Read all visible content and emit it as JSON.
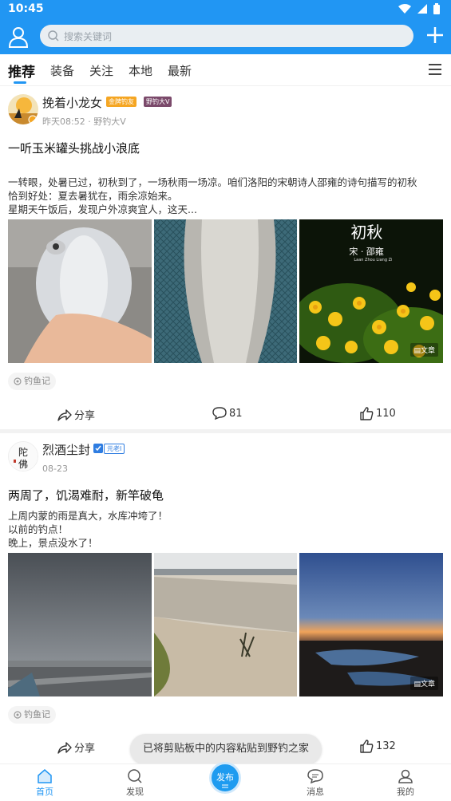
{
  "status_bar": {
    "time": "10:45"
  },
  "search": {
    "placeholder": "搜索关键词"
  },
  "tabs": [
    {
      "label": "推荐",
      "active": true
    },
    {
      "label": "装备"
    },
    {
      "label": "关注"
    },
    {
      "label": "本地"
    },
    {
      "label": "最新"
    }
  ],
  "posts": [
    {
      "author": "挽着小龙女",
      "badges": [
        "金牌钓友",
        "野钓大V"
      ],
      "meta": "昨天08:52 · 野钓大V",
      "title": "一听玉米罐头挑战小浪底",
      "body": [
        "一转眼，处暑已过，初秋到了，一场秋雨一场凉。咱们洛阳的宋朝诗人邵雍的诗句描写的初秋",
        "恰到好处：夏去暑犹在，雨余凉始来。",
        "星期天午饭后，发现户外凉爽宜人，这天..."
      ],
      "images": [
        {
          "desc": "fish-in-hand"
        },
        {
          "desc": "fish-in-net"
        },
        {
          "desc": "poem-flowers",
          "caption_title": "初秋",
          "caption_sub": "宋 · 邵雍",
          "caption_pinyin": "Laan Zhou Liang Zi",
          "tag": "文章"
        }
      ],
      "topic": "钓鱼记",
      "share_label": "分享",
      "comments": "81",
      "likes": "110"
    },
    {
      "author": "烈酒尘封",
      "badges": [
        "元老Ⅰ"
      ],
      "meta": "08-23",
      "title": "两周了，饥渴难耐，新竿破龟",
      "body": [
        "上周内蒙的雨是真大，水库冲垮了！",
        "以前的钓点！",
        "晚上，景点没水了！"
      ],
      "images": [
        {
          "desc": "stormy-sky-road"
        },
        {
          "desc": "dry-reservoir"
        },
        {
          "desc": "sunset-water",
          "tag": "文章"
        }
      ],
      "topic": "钓鱼记",
      "share_label": "分享",
      "likes": "132"
    }
  ],
  "toast": "已将剪贴板中的内容粘贴到野钓之家",
  "bottom_nav": [
    {
      "label": "首页",
      "icon": "home-icon",
      "active": true
    },
    {
      "label": "发现",
      "icon": "discover-icon"
    },
    {
      "label": "发布",
      "icon": "publish-icon"
    },
    {
      "label": "消息",
      "icon": "message-icon"
    },
    {
      "label": "我的",
      "icon": "profile-icon"
    }
  ],
  "colors": {
    "primary": "#2196f3",
    "gold_badge": "#f5a623",
    "purple_badge": "#7b4a6b",
    "blue_badge": "#2f7de1"
  }
}
